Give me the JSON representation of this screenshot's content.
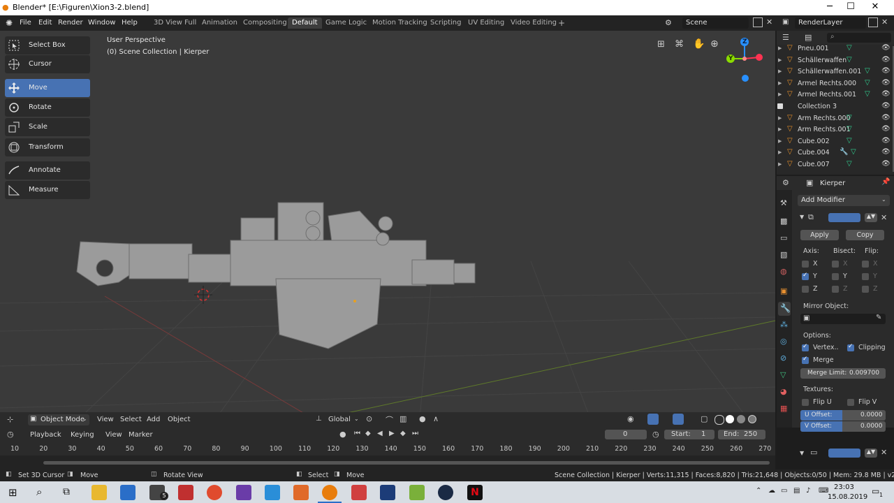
{
  "window": {
    "title": "Blender* [E:\\Figuren\\Xion3-2.blend]",
    "minimize": "─",
    "maximize": "☐",
    "close": "✕"
  },
  "menu": {
    "items": [
      "File",
      "Edit",
      "Render",
      "Window",
      "Help"
    ]
  },
  "workspaces": {
    "tabs": [
      "3D View Full",
      "Animation",
      "Compositing",
      "Default",
      "Game Logic",
      "Motion Tracking",
      "Scripting",
      "UV Editing",
      "Video Editing"
    ],
    "active": "Default",
    "add": "+"
  },
  "scene": {
    "name": "Scene",
    "render_layer": "RenderLayer"
  },
  "viewport": {
    "overlay_line1": "User Perspective",
    "overlay_line2": "(0) Scene Collection | Kierper",
    "gizmo": {
      "z": "Z",
      "y": "Y"
    },
    "colors": {
      "x_axis": "#ff3352",
      "y_axis": "#8bdc00",
      "z_axis": "#2890ff"
    }
  },
  "toolbar": {
    "tools": [
      {
        "label": "Select Box",
        "icon": "select-box-icon"
      },
      {
        "label": "Cursor",
        "icon": "cursor-icon"
      },
      {
        "label": "Move",
        "icon": "move-icon",
        "active": true
      },
      {
        "label": "Rotate",
        "icon": "rotate-icon"
      },
      {
        "label": "Scale",
        "icon": "scale-icon"
      },
      {
        "label": "Transform",
        "icon": "transform-icon"
      },
      {
        "label": "Annotate",
        "icon": "annotate-icon"
      },
      {
        "label": "Measure",
        "icon": "measure-icon"
      }
    ]
  },
  "vp_header": {
    "mode": "Object Mode",
    "menus": [
      "View",
      "Select",
      "Add",
      "Object"
    ],
    "orientation": "Global"
  },
  "outliner": {
    "rows": [
      {
        "label": "Pneu.001",
        "type": "mesh"
      },
      {
        "label": "Schällerwaffen",
        "type": "mesh"
      },
      {
        "label": "Schällerwaffen.001",
        "type": "mesh"
      },
      {
        "label": "Armel Rechts.000",
        "type": "mesh"
      },
      {
        "label": "Armel Rechts.001",
        "type": "mesh"
      },
      {
        "label": "Collection 3",
        "type": "collection"
      },
      {
        "label": "Arm Rechts.000",
        "type": "mesh"
      },
      {
        "label": "Arm Rechts.001",
        "type": "mesh"
      },
      {
        "label": "Cube.002",
        "type": "mesh"
      },
      {
        "label": "Cube.004",
        "type": "mesh-mod"
      },
      {
        "label": "Cube.007",
        "type": "mesh"
      }
    ]
  },
  "properties": {
    "object": "Kierper",
    "add_modifier": "Add Modifier",
    "apply": "Apply",
    "copy": "Copy",
    "axis_label": "Axis:",
    "bisect_label": "Bisect:",
    "flip_label": "Flip:",
    "axes": [
      "X",
      "Y",
      "Z"
    ],
    "mirror_object": "Mirror Object:",
    "options": "Options:",
    "vertex": "Vertex..",
    "clipping": "Clipping",
    "merge": "Merge",
    "merge_limit": "Merge Limit:",
    "merge_limit_value": "0.009700",
    "textures": "Textures:",
    "flip_u": "Flip U",
    "flip_v": "Flip V",
    "u_offset": "U Offset:",
    "u_offset_value": "0.0000",
    "v_offset": "V Offset:",
    "v_offset_value": "0.0000"
  },
  "timeline": {
    "menus": [
      "Playback",
      "Keying",
      "View",
      "Marker"
    ],
    "current_frame": "0",
    "start_label": "Start:",
    "start": "1",
    "end_label": "End:",
    "end": "250",
    "ticks": [
      "10",
      "20",
      "30",
      "40",
      "50",
      "60",
      "70",
      "80",
      "90",
      "100",
      "110",
      "120",
      "130",
      "140",
      "150",
      "160",
      "170",
      "180",
      "190",
      "200",
      "210",
      "220",
      "230",
      "240",
      "250",
      "260",
      "270"
    ]
  },
  "status": {
    "left1": "Set 3D Cursor",
    "left2": "Move",
    "left3": "Rotate View",
    "mid1": "Select",
    "mid2": "Move",
    "right": "Scene Collection | Kierper | Verts:11,315 | Faces:8,820 | Tris:21,648 | Objects:0/50 | Mem: 29.8 MB | v2.80.75"
  },
  "taskbar": {
    "time": "23:03",
    "date": "15.08.2019",
    "badge": "5",
    "notif": "1"
  }
}
